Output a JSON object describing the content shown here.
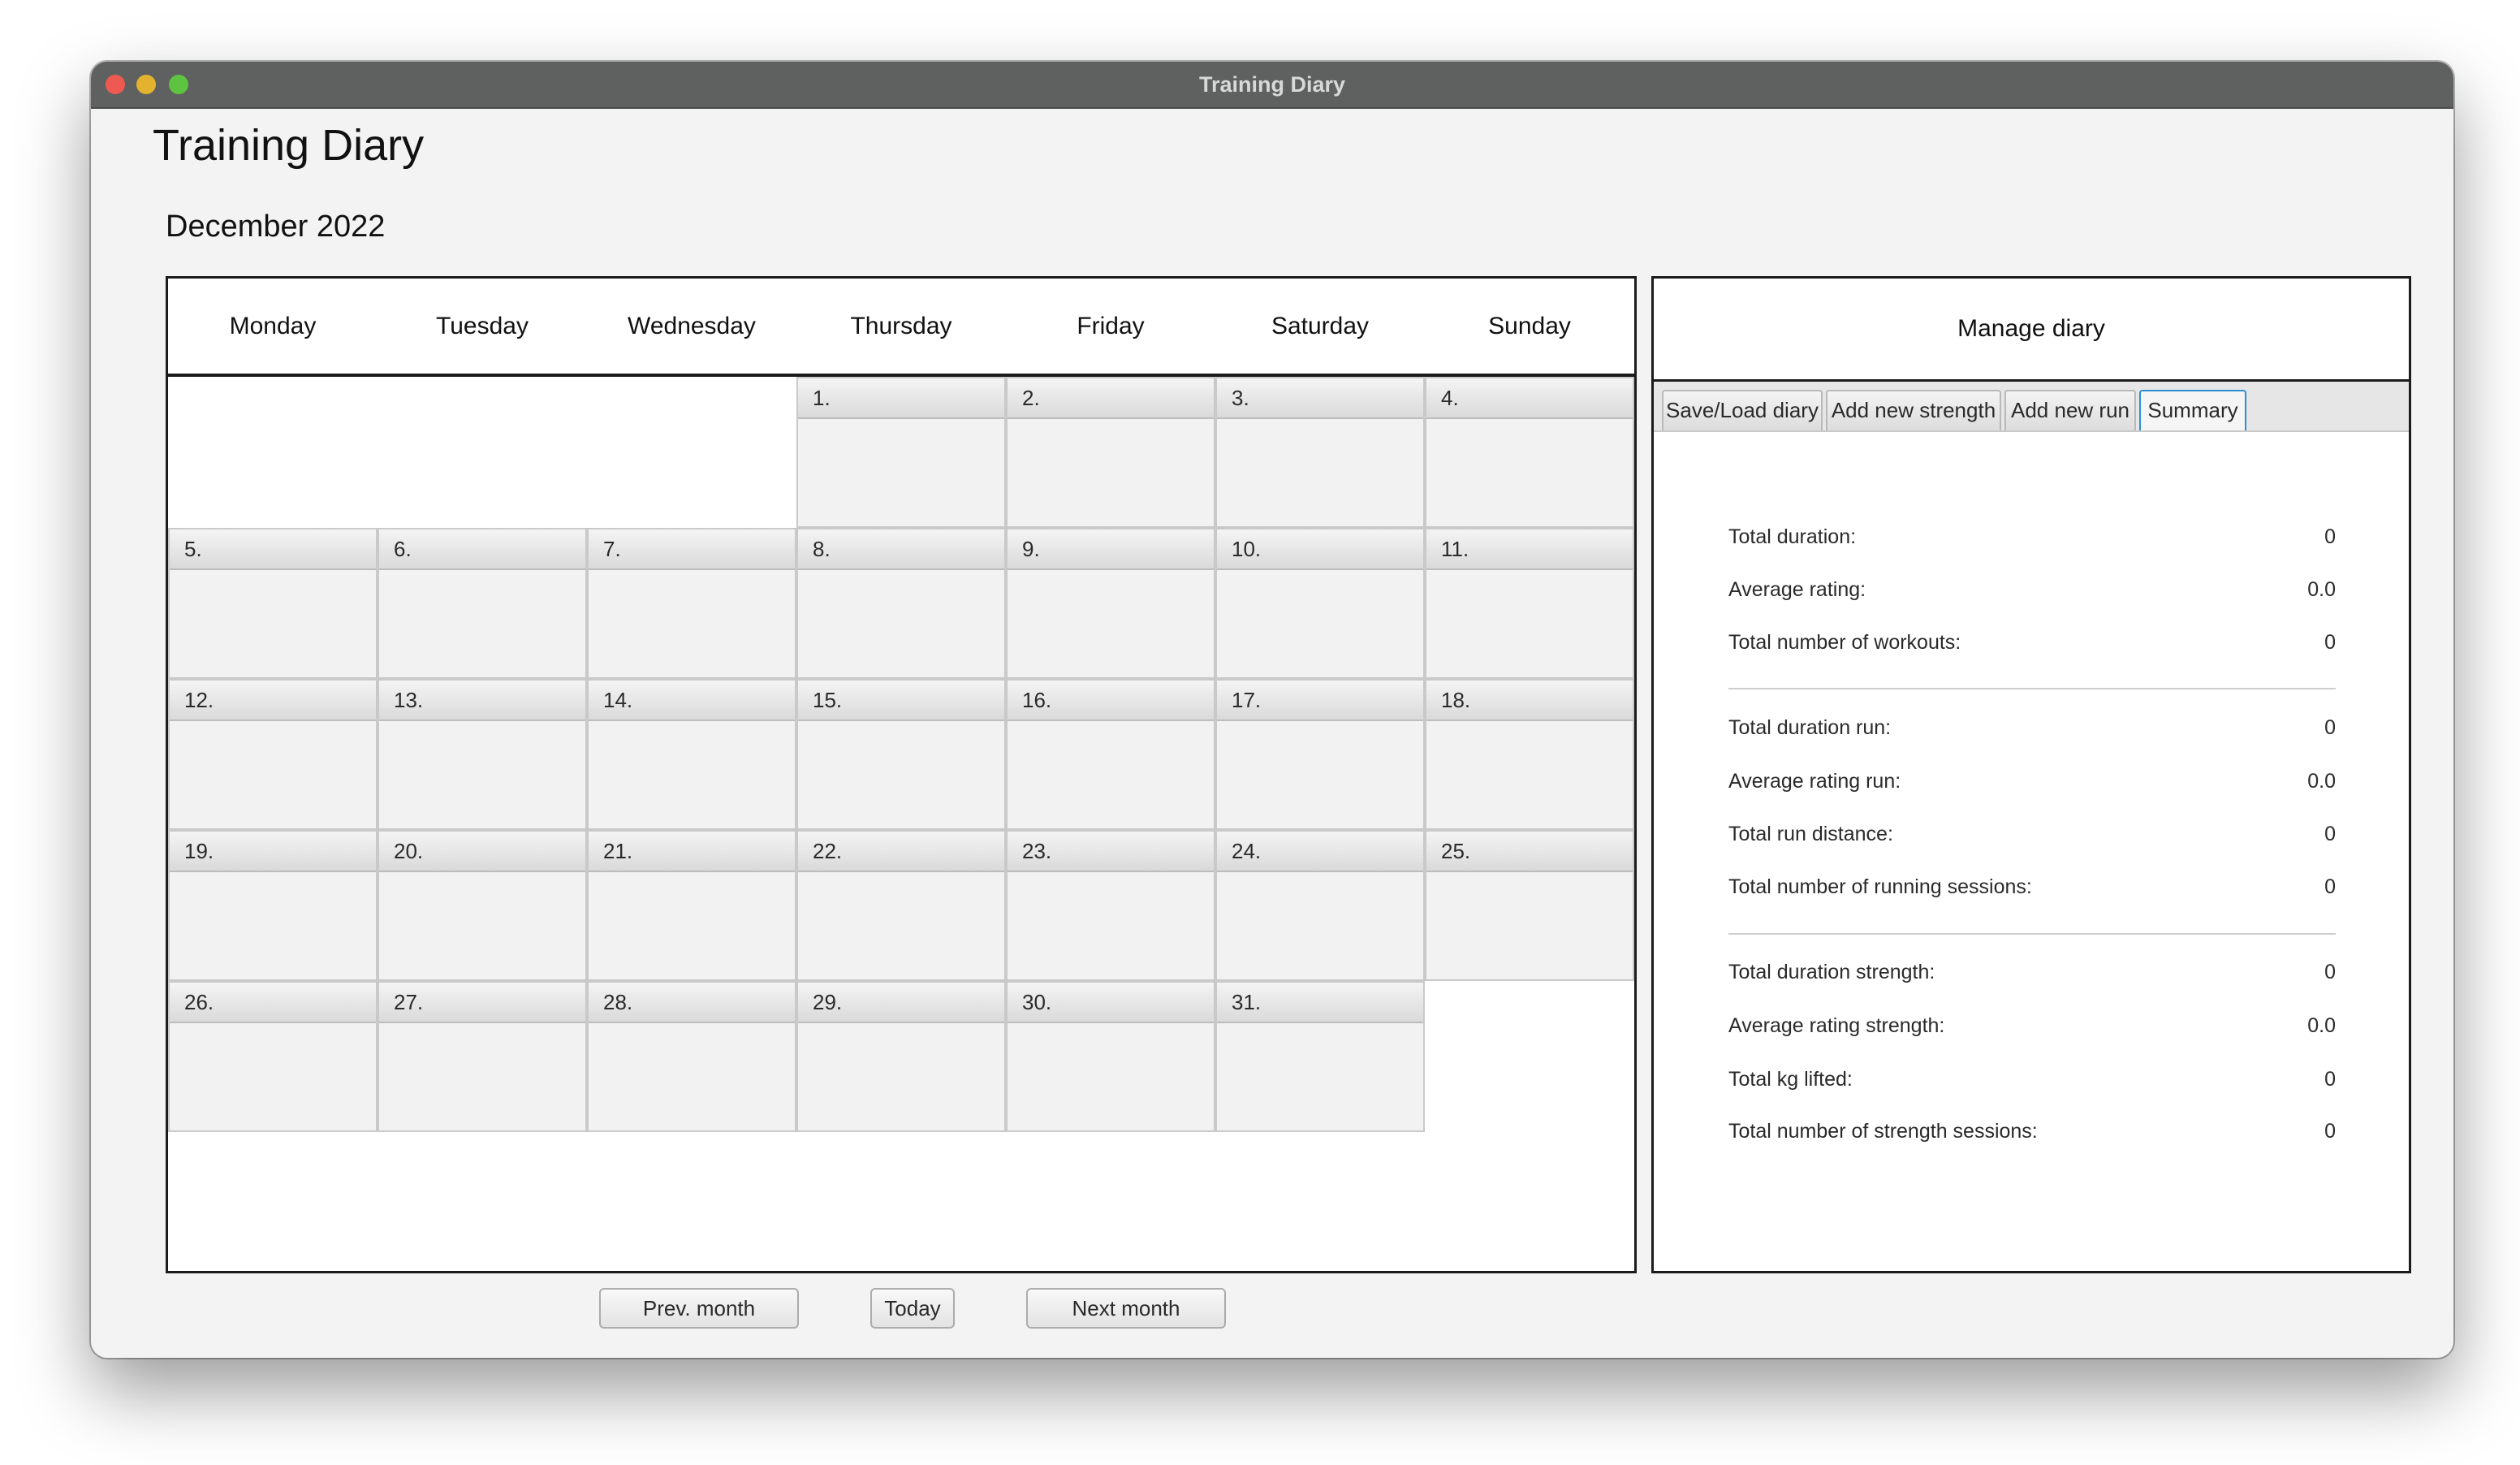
{
  "window": {
    "title": "Training Diary"
  },
  "app_title": "Training Diary",
  "calendar": {
    "month_label": "December 2022",
    "weekdays": [
      "Monday",
      "Tuesday",
      "Wednesday",
      "Thursday",
      "Friday",
      "Saturday",
      "Sunday"
    ],
    "days": [
      "1.",
      "2.",
      "3.",
      "4.",
      "5.",
      "6.",
      "7.",
      "8.",
      "9.",
      "10.",
      "11.",
      "12.",
      "13.",
      "14.",
      "15.",
      "16.",
      "17.",
      "18.",
      "19.",
      "20.",
      "21.",
      "22.",
      "23.",
      "24.",
      "25.",
      "26.",
      "27.",
      "28.",
      "29.",
      "30.",
      "31."
    ]
  },
  "nav": {
    "prev": "Prev. month",
    "today": "Today",
    "next": "Next month"
  },
  "manage": {
    "title": "Manage diary",
    "tabs": [
      {
        "label": "Save/Load diary",
        "active": false
      },
      {
        "label": "Add new strength",
        "active": false
      },
      {
        "label": "Add new run",
        "active": false
      },
      {
        "label": "Summary",
        "active": true
      }
    ],
    "summary": [
      {
        "label": "Total duration:",
        "value": "0"
      },
      {
        "label": "Average rating:",
        "value": "0.0"
      },
      {
        "label": "Total number of workouts:",
        "value": "0"
      },
      {
        "label": "Total duration run:",
        "value": "0"
      },
      {
        "label": "Average rating run:",
        "value": "0.0"
      },
      {
        "label": "Total run distance:",
        "value": "0"
      },
      {
        "label": "Total number of running sessions:",
        "value": "0"
      },
      {
        "label": "Total duration strength:",
        "value": "0"
      },
      {
        "label": "Average rating strength:",
        "value": "0.0"
      },
      {
        "label": "Total kg lifted:",
        "value": "0"
      },
      {
        "label": "Total number of strength sessions:",
        "value": "0"
      }
    ]
  },
  "colors": {
    "titlebar": "#5f6161",
    "active_tab_border": "#2d8fd2"
  }
}
